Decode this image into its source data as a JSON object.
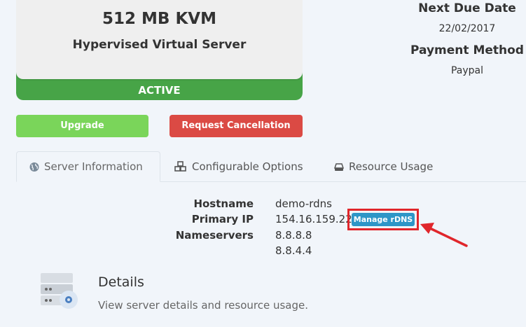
{
  "product": {
    "name": "512 MB KVM",
    "description": "Hypervised Virtual Server",
    "status": "ACTIVE"
  },
  "billing": {
    "next_due_label": "Next Due Date",
    "next_due_value": "22/02/2017",
    "payment_label": "Payment Method",
    "payment_value": "Paypal"
  },
  "actions": {
    "upgrade_label": "Upgrade",
    "cancel_label": "Request Cancellation"
  },
  "tabs": [
    {
      "label": "Server Information",
      "icon": "globe-icon",
      "active": true
    },
    {
      "label": "Configurable Options",
      "icon": "cubes-icon",
      "active": false
    },
    {
      "label": "Resource Usage",
      "icon": "hdd-icon",
      "active": false
    }
  ],
  "server_info": {
    "hostname_label": "Hostname",
    "hostname_value": "demo-rdns",
    "primary_ip_label": "Primary IP",
    "primary_ip_value": "154.16.159.225",
    "manage_rdns_label": "Manage rDNS",
    "nameservers_label": "Nameservers",
    "nameservers": [
      "8.8.8.8",
      "8.8.4.4"
    ]
  },
  "details": {
    "title": "Details",
    "description": "View server details and resource usage."
  },
  "colors": {
    "status_green": "#47a447",
    "upgrade_green": "#7ad55a",
    "cancel_red": "#db4a44",
    "rdns_blue": "#2d96c7",
    "highlight_red": "#e0262b"
  }
}
